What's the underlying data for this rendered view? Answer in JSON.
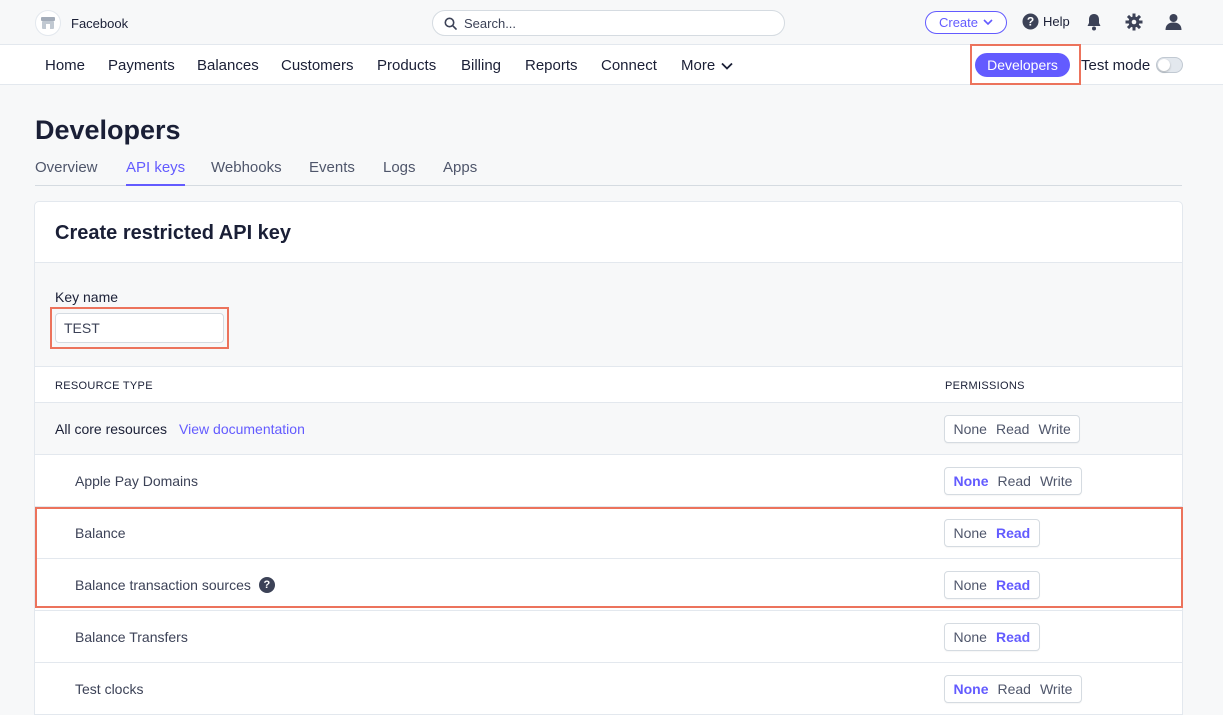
{
  "topbar": {
    "account_name": "Facebook",
    "search_placeholder": "Search...",
    "create_label": "Create",
    "help_label": "Help"
  },
  "mainnav": {
    "items": [
      "Home",
      "Payments",
      "Balances",
      "Customers",
      "Products",
      "Billing",
      "Reports",
      "Connect",
      "More"
    ],
    "developers_label": "Developers",
    "test_mode_label": "Test mode",
    "test_mode_on": false
  },
  "page": {
    "title": "Developers",
    "tabs": [
      "Overview",
      "API keys",
      "Webhooks",
      "Events",
      "Logs",
      "Apps"
    ],
    "active_tab": "API keys"
  },
  "card": {
    "title": "Create restricted API key",
    "key_name_label": "Key name",
    "key_name_value": "TEST",
    "col_resource": "RESOURCE TYPE",
    "col_permissions": "PERMISSIONS",
    "core_label": "All core resources",
    "core_doc_link": "View documentation",
    "rows": [
      {
        "label": "Apple Pay Domains",
        "options": [
          "None",
          "Read",
          "Write"
        ],
        "selected": "None"
      },
      {
        "label": "Balance",
        "options": [
          "None",
          "Read"
        ],
        "selected": "Read"
      },
      {
        "label": "Balance transaction sources",
        "options": [
          "None",
          "Read"
        ],
        "selected": "Read",
        "help_icon": true
      },
      {
        "label": "Balance Transfers",
        "options": [
          "None",
          "Read"
        ],
        "selected": "Read"
      },
      {
        "label": "Test clocks",
        "options": [
          "None",
          "Read",
          "Write"
        ],
        "selected": "None"
      }
    ],
    "core_options": [
      "None",
      "Read",
      "Write"
    ]
  },
  "colors": {
    "accent": "#635bff",
    "highlight": "#ec735c"
  }
}
